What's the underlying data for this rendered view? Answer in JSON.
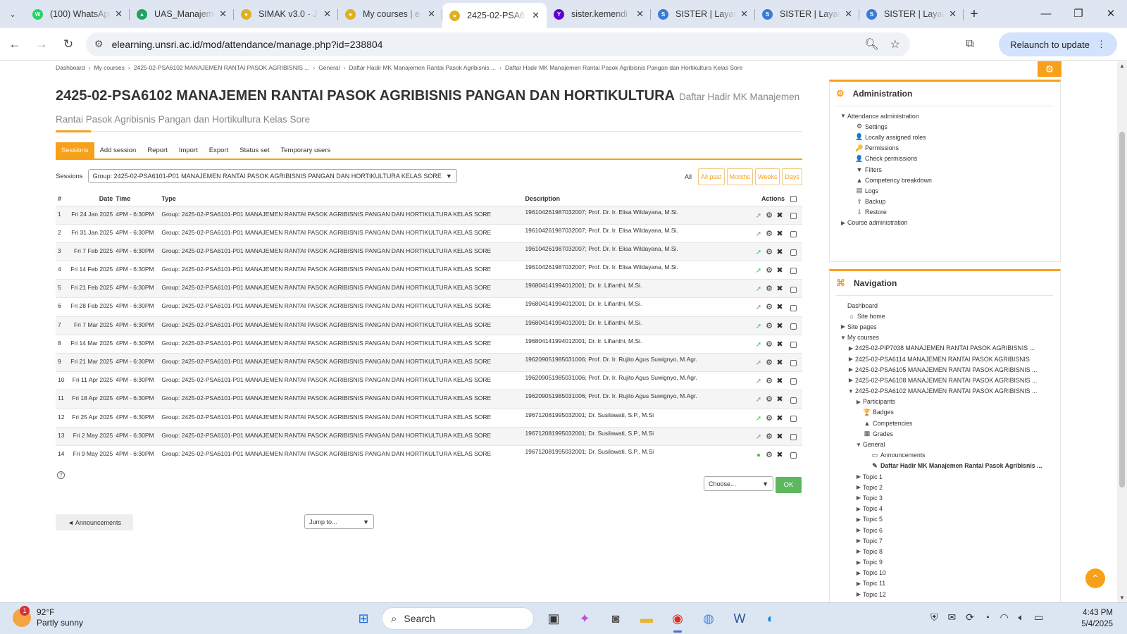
{
  "browser": {
    "tabs": [
      {
        "title": "(100) WhatsApp",
        "color": "#25d366",
        "glyph": "W",
        "active": false
      },
      {
        "title": "UAS_Manajemen",
        "color": "#1ea362",
        "glyph": "▲",
        "active": false
      },
      {
        "title": "SIMAK v3.0 - J",
        "color": "#e0b020",
        "glyph": "●",
        "active": false
      },
      {
        "title": "My courses | e",
        "color": "#e0b020",
        "glyph": "●",
        "active": false
      },
      {
        "title": "2425-02-PSA6",
        "color": "#e0b020",
        "glyph": "●",
        "active": true
      },
      {
        "title": "sister.kemendi",
        "color": "#6001d2",
        "glyph": "Y",
        "active": false
      },
      {
        "title": "SISTER | Layan",
        "color": "#3a7bd5",
        "glyph": "S",
        "active": false
      },
      {
        "title": "SISTER | Layan",
        "color": "#3a7bd5",
        "glyph": "S",
        "active": false
      },
      {
        "title": "SISTER | Layan",
        "color": "#3a7bd5",
        "glyph": "S",
        "active": false
      }
    ],
    "url_domain": "elearning.unsri.ac.id",
    "url_path": "/mod/attendance/manage.php?id=238804",
    "relaunch_label": "Relaunch to update"
  },
  "breadcrumb": [
    "Dashboard",
    "My courses",
    "2425-02-PSA6102 MANAJEMEN RANTAI PASOK AGRIBISNIS ...",
    "General",
    "Daftar Hadir MK Manajemen Rantai Pasok Agribisnis ...",
    "Daftar Hadir MK Manajemen Rantai Pasok Agribisnis Pangan dan Hortikultura Kelas Sore"
  ],
  "heading": {
    "title": "2425-02-PSA6102 MANAJEMEN RANTAI PASOK AGRIBISNIS PANGAN DAN HORTIKULTURA",
    "subtitle": "Daftar Hadir MK Manajemen Rantai Pasok Agribisnis Pangan dan Hortikultura Kelas Sore"
  },
  "page_tabs": [
    "Sessions",
    "Add session",
    "Report",
    "Import",
    "Export",
    "Status set",
    "Temporary users"
  ],
  "sessions_filter": {
    "label": "Sessions",
    "selected": "Group: 2425-02-PSA6101-P01 MANAJEMEN RANTAI PASOK AGRIBISNIS PANGAN DAN HORTIKULTURA KELAS SORE"
  },
  "view_buttons": {
    "label": "All",
    "buttons": [
      "All past",
      "Months",
      "Weeks",
      "Days"
    ]
  },
  "table": {
    "headers": {
      "num": "#",
      "date": "Date",
      "time": "Time",
      "type": "Type",
      "description": "Description",
      "actions": "Actions"
    },
    "rows": [
      {
        "num": "1",
        "date": "Fri 24 Jan 2025",
        "time": "4PM - 6:30PM",
        "type": "Group: 2425-02-PSA6101-P01 MANAJEMEN RANTAI PASOK AGRIBISNIS PANGAN DAN HORTIKULTURA KELAS SORE",
        "desc": "196104261987032007; Prof. Dr. Ir. Elisa Wildayana, M.Si."
      },
      {
        "num": "2",
        "date": "Fri 31 Jan 2025",
        "time": "4PM - 6:30PM",
        "type": "Group: 2425-02-PSA6101-P01 MANAJEMEN RANTAI PASOK AGRIBISNIS PANGAN DAN HORTIKULTURA KELAS SORE",
        "desc": "196104261987032007; Prof. Dr. Ir. Elisa Wildayana, M.Si."
      },
      {
        "num": "3",
        "date": "Fri 7 Feb 2025",
        "time": "4PM - 6:30PM",
        "type": "Group: 2425-02-PSA6101-P01 MANAJEMEN RANTAI PASOK AGRIBISNIS PANGAN DAN HORTIKULTURA KELAS SORE",
        "desc": "196104261987032007; Prof. Dr. Ir. Elisa Wildayana, M.Si."
      },
      {
        "num": "4",
        "date": "Fri 14 Feb 2025",
        "time": "4PM - 6:30PM",
        "type": "Group: 2425-02-PSA6101-P01 MANAJEMEN RANTAI PASOK AGRIBISNIS PANGAN DAN HORTIKULTURA KELAS SORE",
        "desc": "196104261987032007; Prof. Dr. Ir. Elisa Wildayana, M.Si."
      },
      {
        "num": "5",
        "date": "Fri 21 Feb 2025",
        "time": "4PM - 6:30PM",
        "type": "Group: 2425-02-PSA6101-P01 MANAJEMEN RANTAI PASOK AGRIBISNIS PANGAN DAN HORTIKULTURA KELAS SORE",
        "desc": "196804141994012001; Dr. Ir. Lifianthi, M.Si."
      },
      {
        "num": "6",
        "date": "Fri 28 Feb 2025",
        "time": "4PM - 6:30PM",
        "type": "Group: 2425-02-PSA6101-P01 MANAJEMEN RANTAI PASOK AGRIBISNIS PANGAN DAN HORTIKULTURA KELAS SORE",
        "desc": "196804141994012001; Dr. Ir. Lifianthi, M.Si."
      },
      {
        "num": "7",
        "date": "Fri 7 Mar 2025",
        "time": "4PM - 6:30PM",
        "type": "Group: 2425-02-PSA6101-P01 MANAJEMEN RANTAI PASOK AGRIBISNIS PANGAN DAN HORTIKULTURA KELAS SORE",
        "desc": "196804141994012001; Dr. Ir. Lifianthi, M.Si."
      },
      {
        "num": "8",
        "date": "Fri 14 Mar 2025",
        "time": "4PM - 6:30PM",
        "type": "Group: 2425-02-PSA6101-P01 MANAJEMEN RANTAI PASOK AGRIBISNIS PANGAN DAN HORTIKULTURA KELAS SORE",
        "desc": "196804141994012001; Dr. Ir. Lifianthi, M.Si."
      },
      {
        "num": "9",
        "date": "Fri 21 Mar 2025",
        "time": "4PM - 6:30PM",
        "type": "Group: 2425-02-PSA6101-P01 MANAJEMEN RANTAI PASOK AGRIBISNIS PANGAN DAN HORTIKULTURA KELAS SORE",
        "desc": "196209051985031006; Prof. Dr. Ir. Rujito Agus Suwignyo, M.Agr."
      },
      {
        "num": "10",
        "date": "Fri 11 Apr 2025",
        "time": "4PM - 6:30PM",
        "type": "Group: 2425-02-PSA6101-P01 MANAJEMEN RANTAI PASOK AGRIBISNIS PANGAN DAN HORTIKULTURA KELAS SORE",
        "desc": "196209051985031006; Prof. Dr. Ir. Rujito Agus Suwignyo, M.Agr."
      },
      {
        "num": "11",
        "date": "Fri 18 Apr 2025",
        "time": "4PM - 6:30PM",
        "type": "Group: 2425-02-PSA6101-P01 MANAJEMEN RANTAI PASOK AGRIBISNIS PANGAN DAN HORTIKULTURA KELAS SORE",
        "desc": "196209051985031006; Prof. Dr. Ir. Rujito Agus Suwignyo, M.Agr."
      },
      {
        "num": "12",
        "date": "Fri 25 Apr 2025",
        "time": "4PM - 6:30PM",
        "type": "Group: 2425-02-PSA6101-P01 MANAJEMEN RANTAI PASOK AGRIBISNIS PANGAN DAN HORTIKULTURA KELAS SORE",
        "desc": "196712081995032001; Dr. Susilawati, S.P., M.Si"
      },
      {
        "num": "13",
        "date": "Fri 2 May 2025",
        "time": "4PM - 6:30PM",
        "type": "Group: 2425-02-PSA6101-P01 MANAJEMEN RANTAI PASOK AGRIBISNIS PANGAN DAN HORTIKULTURA KELAS SORE",
        "desc": "196712081995032001; Dr. Susilawati, S.P., M.Si"
      },
      {
        "num": "14",
        "date": "Fri 9 May 2025",
        "time": "4PM - 6:30PM",
        "type": "Group: 2425-02-PSA6101-P01 MANAJEMEN RANTAI PASOK AGRIBISNIS PANGAN DAN HORTIKULTURA KELAS SORE",
        "desc": "196712081995032001; Dr. Susilawati, S.P., M.Si"
      }
    ]
  },
  "bulk": {
    "choose": "Choose...",
    "ok": "OK"
  },
  "footer_nav": {
    "prev": "◄ Announcements",
    "jump": "Jump to..."
  },
  "admin_block": {
    "title": "Administration",
    "items": [
      {
        "label": "Attendance administration",
        "tw": "▼",
        "icon": "",
        "indent": 0
      },
      {
        "label": "Settings",
        "tw": "",
        "icon": "⚙",
        "indent": 1
      },
      {
        "label": "Locally assigned roles",
        "tw": "",
        "icon": "👤",
        "indent": 1
      },
      {
        "label": "Permissions",
        "tw": "",
        "icon": "🔑",
        "indent": 1
      },
      {
        "label": "Check permissions",
        "tw": "",
        "icon": "👤",
        "indent": 1
      },
      {
        "label": "Filters",
        "tw": "",
        "icon": "▼",
        "indent": 1
      },
      {
        "label": "Competency breakdown",
        "tw": "",
        "icon": "▲",
        "indent": 1
      },
      {
        "label": "Logs",
        "tw": "",
        "icon": "▤",
        "indent": 1
      },
      {
        "label": "Backup",
        "tw": "",
        "icon": "⇪",
        "indent": 1
      },
      {
        "label": "Restore",
        "tw": "",
        "icon": "⇩",
        "indent": 1
      },
      {
        "label": "Course administration",
        "tw": "▶",
        "icon": "",
        "indent": 0
      }
    ]
  },
  "nav_block": {
    "title": "Navigation",
    "items": [
      {
        "label": "Dashboard",
        "tw": "",
        "icon": "",
        "indent": 0,
        "bold": false
      },
      {
        "label": "Site home",
        "tw": "",
        "icon": "⌂",
        "indent": 0,
        "bold": false
      },
      {
        "label": "Site pages",
        "tw": "▶",
        "icon": "",
        "indent": 0,
        "bold": false
      },
      {
        "label": "My courses",
        "tw": "▼",
        "icon": "",
        "indent": 0,
        "bold": false
      },
      {
        "label": "2425-02-PIP7038 MANAJEMEN RANTAI PASOK AGRIBISNIS ...",
        "tw": "▶",
        "icon": "",
        "indent": 1,
        "bold": false
      },
      {
        "label": "2425-02-PSA6114 MANAJEMEN RANTAI PASOK AGRIBISNIS",
        "tw": "▶",
        "icon": "",
        "indent": 1,
        "bold": false
      },
      {
        "label": "2425-02-PSA6105 MANAJEMEN RANTAI PASOK AGRIBISNIS ...",
        "tw": "▶",
        "icon": "",
        "indent": 1,
        "bold": false
      },
      {
        "label": "2425-02-PSA6108 MANAJEMEN RANTAI PASOK AGRIBISNIS ...",
        "tw": "▶",
        "icon": "",
        "indent": 1,
        "bold": false
      },
      {
        "label": "2425-02-PSA6102 MANAJEMEN RANTAI PASOK AGRIBISNIS ...",
        "tw": "▼",
        "icon": "",
        "indent": 1,
        "bold": false
      },
      {
        "label": "Participants",
        "tw": "▶",
        "icon": "",
        "indent": 2,
        "bold": false
      },
      {
        "label": "Badges",
        "tw": "",
        "icon": "🏆",
        "indent": 2,
        "bold": false
      },
      {
        "label": "Competencies",
        "tw": "",
        "icon": "▲",
        "indent": 2,
        "bold": false
      },
      {
        "label": "Grades",
        "tw": "",
        "icon": "▦",
        "indent": 2,
        "bold": false
      },
      {
        "label": "General",
        "tw": "▼",
        "icon": "",
        "indent": 2,
        "bold": false
      },
      {
        "label": "Announcements",
        "tw": "",
        "icon": "▭",
        "indent": 3,
        "bold": false
      },
      {
        "label": "Daftar Hadir MK Manajemen Rantai Pasok Agribisnis ...",
        "tw": "",
        "icon": "✎",
        "indent": 3,
        "bold": true
      },
      {
        "label": "Topic 1",
        "tw": "▶",
        "icon": "",
        "indent": 2,
        "bold": false
      },
      {
        "label": "Topic 2",
        "tw": "▶",
        "icon": "",
        "indent": 2,
        "bold": false
      },
      {
        "label": "Topic 3",
        "tw": "▶",
        "icon": "",
        "indent": 2,
        "bold": false
      },
      {
        "label": "Topic 4",
        "tw": "▶",
        "icon": "",
        "indent": 2,
        "bold": false
      },
      {
        "label": "Topic 5",
        "tw": "▶",
        "icon": "",
        "indent": 2,
        "bold": false
      },
      {
        "label": "Topic 6",
        "tw": "▶",
        "icon": "",
        "indent": 2,
        "bold": false
      },
      {
        "label": "Topic 7",
        "tw": "▶",
        "icon": "",
        "indent": 2,
        "bold": false
      },
      {
        "label": "Topic 8",
        "tw": "▶",
        "icon": "",
        "indent": 2,
        "bold": false
      },
      {
        "label": "Topic 9",
        "tw": "▶",
        "icon": "",
        "indent": 2,
        "bold": false
      },
      {
        "label": "Topic 10",
        "tw": "▶",
        "icon": "",
        "indent": 2,
        "bold": false
      },
      {
        "label": "Topic 11",
        "tw": "▶",
        "icon": "",
        "indent": 2,
        "bold": false
      },
      {
        "label": "Topic 12",
        "tw": "▶",
        "icon": "",
        "indent": 2,
        "bold": false
      }
    ]
  },
  "taskbar": {
    "weather_temp": "92°F",
    "weather_desc": "Partly sunny",
    "weather_badge": "1",
    "search_label": "Search",
    "time": "4:43 PM",
    "date": "5/4/2025"
  },
  "colors": {
    "accent": "#f7a01a",
    "ok": "#5cb85c"
  }
}
